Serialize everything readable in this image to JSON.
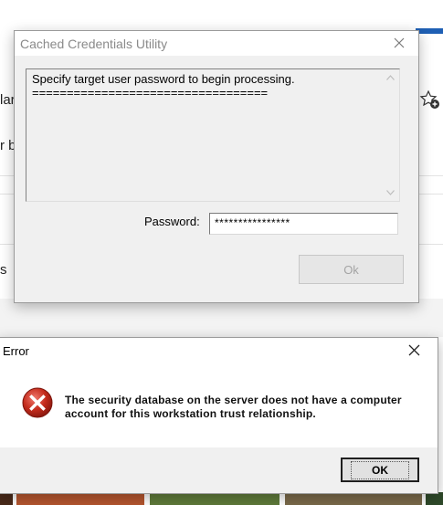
{
  "background": {
    "fragments": [
      "lar",
      "r b",
      "s"
    ]
  },
  "cached_credentials_dialog": {
    "title": "Cached Credentials Utility",
    "message_line1": "Specify target user password to begin processing.",
    "message_line2": "==================================",
    "password_label": "Password:",
    "password_value": "****************",
    "ok_label": "Ok"
  },
  "error_dialog": {
    "title": "Error",
    "message": "The security database on the server does not have a computer account for this workstation trust relationship.",
    "ok_label": "OK",
    "icon": "error-icon"
  },
  "colors": {
    "error_red": "#c42b1c",
    "accent_blue": "#1e5fb4"
  }
}
